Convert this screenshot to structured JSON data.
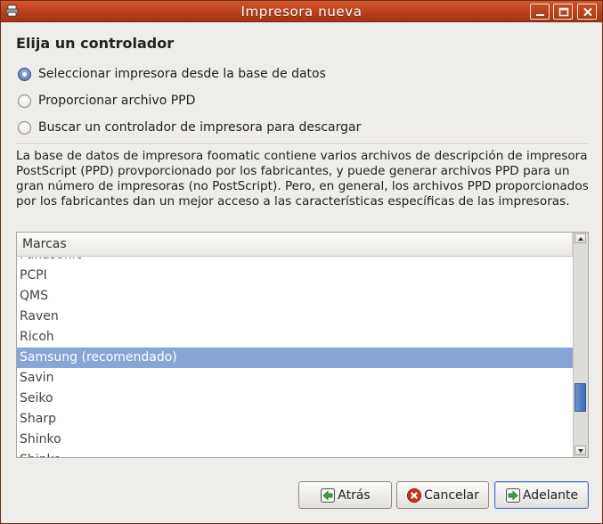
{
  "window": {
    "title": "Impresora nueva",
    "app_icon": "printer-icon",
    "controls": [
      "minimize-icon",
      "maximize-icon",
      "close-icon"
    ]
  },
  "heading": "Elija un controlador",
  "options": [
    {
      "label": "Seleccionar impresora desde la base de datos",
      "checked": true
    },
    {
      "label": "Proporcionar archivo PPD",
      "checked": false
    },
    {
      "label": "Buscar un controlador de impresora para descargar",
      "checked": false
    }
  ],
  "description": "La base de datos de impresora foomatic contiene varios archivos de descripción de impresora PostScript (PPD) provporcionado por los fabricantes, y puede generar archivos PPD para un gran número de impresoras (no PostScript). Pero, en general, los archivos PPD proporcionados por los fabricantes dan un mejor acceso a las características específicas de las impresoras.",
  "list": {
    "header": "Marcas",
    "items": [
      "Panasonic",
      "PCPI",
      "QMS",
      "Raven",
      "Ricoh",
      "Samsung (recomendado)",
      "Savin",
      "Seiko",
      "Sharp",
      "Shinko",
      "Shinko"
    ],
    "selected": "Samsung (recomendado)",
    "scroll_position": 0.85
  },
  "buttons": {
    "back": {
      "label": "Atrás",
      "icon": "back-arrow-icon"
    },
    "cancel": {
      "label": "Cancelar",
      "icon": "cancel-icon"
    },
    "forward": {
      "label": "Adelante",
      "icon": "forward-arrow-icon"
    }
  },
  "colors": {
    "titlebar": "#b8401b",
    "selection": "#86a6d6",
    "radio_checked": "#4a70b5"
  }
}
